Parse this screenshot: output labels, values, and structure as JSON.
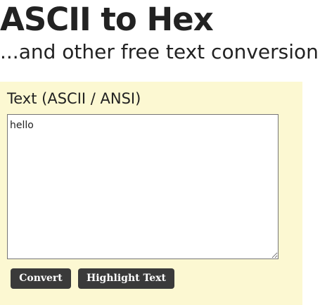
{
  "header": {
    "title": "ASCII to Hex",
    "subtitle": "...and other free text conversion"
  },
  "converter": {
    "heading": "Text (ASCII / ANSI)",
    "input_value": "hello",
    "buttons": {
      "convert_label": "Convert",
      "highlight_label": "Highlight Text"
    }
  },
  "colors": {
    "panel_background": "#fcf8d2",
    "button_background": "#3a3a3a",
    "button_text": "#ffffff",
    "text": "#222222"
  }
}
